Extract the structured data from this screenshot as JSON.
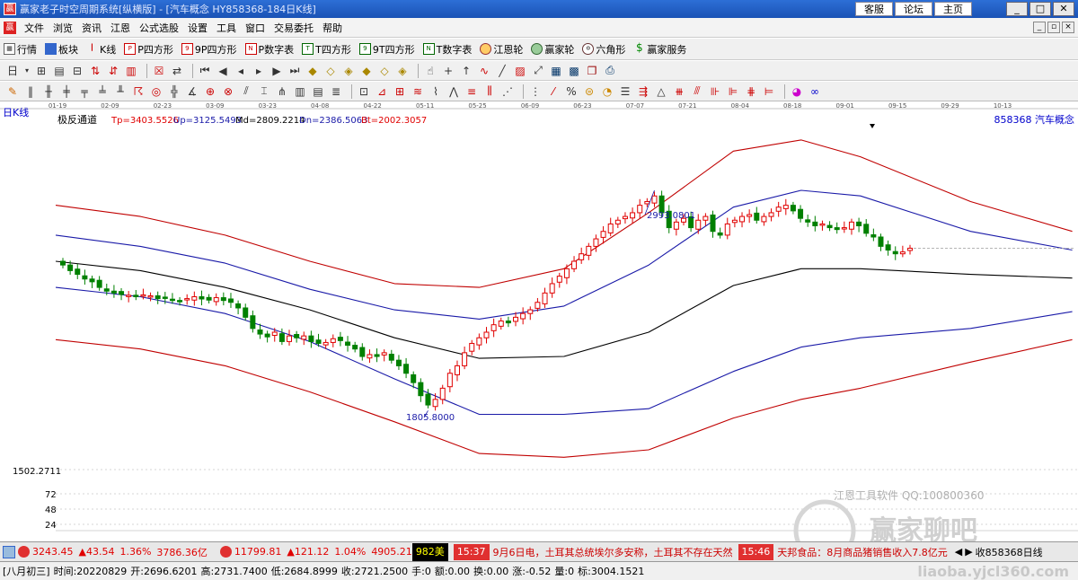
{
  "window": {
    "title": "赢家老子时空周期系统[纵横版] - [汽车概念  HY858368-184日K线]",
    "links": [
      "客服",
      "论坛",
      "主页"
    ]
  },
  "menu": [
    "文件",
    "浏览",
    "资讯",
    "江恩",
    "公式选股",
    "设置",
    "工具",
    "窗口",
    "交易委托",
    "帮助"
  ],
  "toolbar1": [
    {
      "icon": "table-icon",
      "label": "行情"
    },
    {
      "icon": "blocks-icon",
      "label": "板块"
    },
    {
      "icon": "candlestick-icon",
      "label": "K线"
    },
    {
      "icon": "p-square-icon",
      "label": "P四方形"
    },
    {
      "icon": "9p-square-icon",
      "label": "9P四方形"
    },
    {
      "icon": "pn-icon",
      "label": "P数字表"
    },
    {
      "icon": "t-square-icon",
      "label": "T四方形"
    },
    {
      "icon": "9t-square-icon",
      "label": "9T四方形"
    },
    {
      "icon": "tn-icon",
      "label": "T数字表"
    },
    {
      "icon": "gann-wheel-icon",
      "label": "江恩轮"
    },
    {
      "icon": "winner-wheel-icon",
      "label": "赢家轮"
    },
    {
      "icon": "hexagon-icon",
      "label": "六角形"
    },
    {
      "icon": "dollar-icon",
      "label": "赢家服务"
    }
  ],
  "chart_header": {
    "period_label": "日K线",
    "indicator": "极反通道",
    "tp": "Tp=3403.5526",
    "up": "Up=3125.5493",
    "md": "Md=2809.2214",
    "dn": "Dn=2386.5063",
    "bt": "Bt=2002.3057",
    "symbol": "858368  汽车概念"
  },
  "chart_data": {
    "type": "candlestick",
    "x_ticks": [
      "01-19",
      "02-09",
      "02-23",
      "03-09",
      "03-23",
      "04-08",
      "04-22",
      "05-11",
      "05-25",
      "06-09",
      "06-23",
      "07-07",
      "07-21",
      "08-04",
      "08-18",
      "09-01",
      "09-15",
      "09-29",
      "10-13"
    ],
    "annotations": {
      "high": "2993.0801",
      "low": "1805.8000"
    },
    "price_label": "1502.2711",
    "volume_ticks": [
      "72",
      "48",
      "24"
    ],
    "close_series": [
      2620,
      2590,
      2570,
      2545,
      2530,
      2500,
      2480,
      2470,
      2462,
      2458,
      2450,
      2460,
      2455,
      2440,
      2445,
      2430,
      2425,
      2440,
      2450,
      2438,
      2432,
      2445,
      2430,
      2420,
      2390,
      2340,
      2280,
      2250,
      2235,
      2260,
      2210,
      2240,
      2230,
      2240,
      2210,
      2200,
      2205,
      2225,
      2215,
      2190,
      2170,
      2130,
      2140,
      2130,
      2150,
      2110,
      2080,
      2040,
      1990,
      1920,
      1870,
      1900,
      1960,
      2040,
      2080,
      2150,
      2200,
      2230,
      2260,
      2300,
      2320,
      2310,
      2340,
      2360,
      2380,
      2420,
      2470,
      2520,
      2560,
      2600,
      2640,
      2680,
      2720,
      2760,
      2800,
      2840,
      2860,
      2880,
      2900,
      2940,
      2960,
      2990,
      2900,
      2820,
      2850,
      2870,
      2820,
      2860,
      2880,
      2800,
      2780,
      2840,
      2860,
      2880,
      2890,
      2860,
      2880,
      2900,
      2930,
      2940,
      2910,
      2870,
      2850,
      2830,
      2840,
      2820,
      2810,
      2820,
      2850,
      2830,
      2790,
      2770,
      2720,
      2700,
      2680,
      2690,
      2710
    ]
  },
  "statusbar": {
    "sh_index": "3243.45",
    "sh_change": "▲43.54",
    "sh_pct": "1.36%",
    "sh_amount": "3786.36亿",
    "sz_index": "11799.81",
    "sz_change": "▲121.12",
    "sz_pct": "1.04%",
    "sz_amount": "4905.21",
    "extra": "982美",
    "news1_time": "15:37",
    "news1": "9月6日电，土耳其总统埃尔多安称，土耳其不存在天然",
    "news2_time": "15:46",
    "news2": "天邦食品：8月商品猪销售收入7.8亿元",
    "close_label": "收858368日线"
  },
  "bottombar": {
    "date_cn": "[八月初三]",
    "time": "时间:20220829",
    "open": "开:2696.6201",
    "high": "高:2731.7400",
    "low": "低:2684.8999",
    "close": "收:2721.2500",
    "hand": "手:0",
    "amount": "额:0.00",
    "turnover": "换:0.00",
    "change": "涨:-0.52",
    "volume": "量:0",
    "mark": "标:3004.1521"
  },
  "watermark": {
    "company": "江恩工具软件  QQ:100800360",
    "forum": "赢家聊吧",
    "url": "liaoba.yjcl360.com"
  },
  "colors": {
    "up": "#e00000",
    "down": "#008000",
    "outer_band": "#c00000",
    "inner_band": "#1a1aa8",
    "mid_band": "#000000"
  }
}
